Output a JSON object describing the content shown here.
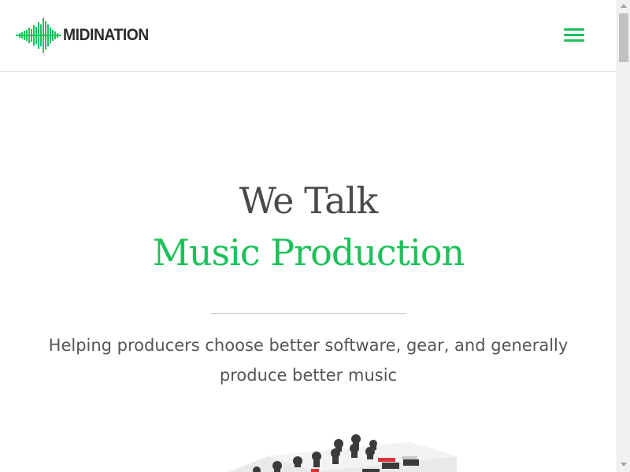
{
  "header": {
    "logo_text": "MIDINATION",
    "logo_icon": "sound-wave-logo-icon",
    "menu_icon": "hamburger-menu-icon"
  },
  "hero": {
    "title_line_1": "We Talk",
    "title_line_2": "Music Production",
    "tagline": "Helping producers choose better software, gear, and generally produce better music",
    "image": "midi-controller-image"
  },
  "colors": {
    "accent": "#1dc15a",
    "text_dark": "#4a4a4a",
    "text_body": "#555555",
    "divider": "#cfcfcf"
  },
  "scrollbar": {
    "up_icon": "scroll-up-arrow-icon",
    "down_icon": "scroll-down-arrow-icon"
  }
}
